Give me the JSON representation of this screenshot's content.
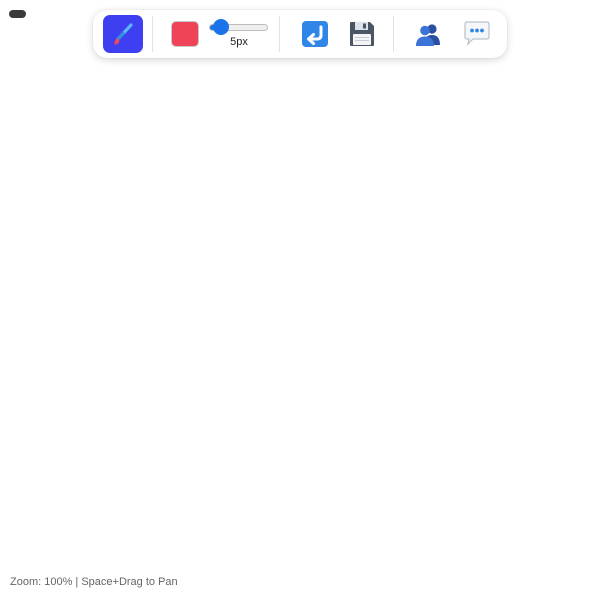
{
  "toolbar": {
    "active_tool": "brush",
    "icons": {
      "brush": "brush-icon",
      "undo": "undo-arrow-icon",
      "save": "floppy-disk-icon",
      "users": "users-icon",
      "chat": "speech-bubble-icon",
      "menu": "menu-pill-icon"
    },
    "color": {
      "current": "#ef4357"
    },
    "brush_size": {
      "value": 5,
      "min": 1,
      "max": 50,
      "label": "5px"
    }
  },
  "colors": {
    "accent": "#3d3ff0",
    "slider": "#1a73e8"
  },
  "status": {
    "text": "Zoom: 100% | Space+Drag to Pan"
  }
}
